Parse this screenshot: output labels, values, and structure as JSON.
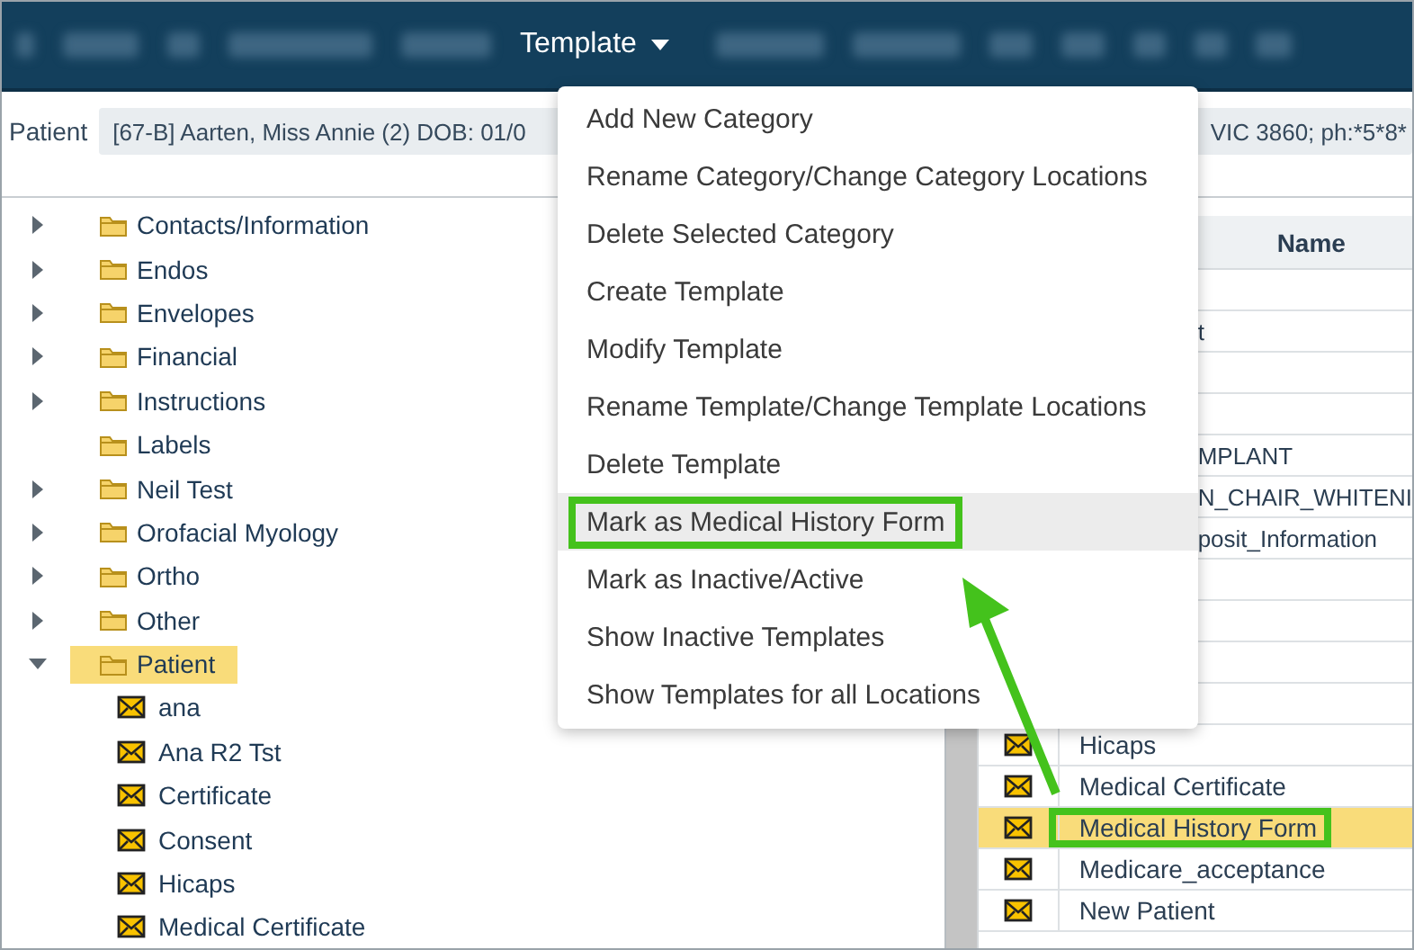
{
  "toolbar": {
    "menus": [
      {
        "label": "Template"
      }
    ]
  },
  "patient_bar": {
    "label": "Patient",
    "value_start": "[67-B] Aarten, Miss Annie (2) DOB: 01/0",
    "value_end": "VIC 3860; ph:*5*8*"
  },
  "tree": [
    {
      "label": "Contacts/Information",
      "expandable": true,
      "expanded": false,
      "selected": false
    },
    {
      "label": "Endos",
      "expandable": true,
      "expanded": false,
      "selected": false
    },
    {
      "label": "Envelopes",
      "expandable": true,
      "expanded": false,
      "selected": false
    },
    {
      "label": "Financial",
      "expandable": true,
      "expanded": false,
      "selected": false
    },
    {
      "label": "Instructions",
      "expandable": true,
      "expanded": false,
      "selected": false
    },
    {
      "label": "Labels",
      "expandable": false,
      "expanded": false,
      "selected": false
    },
    {
      "label": "Neil Test",
      "expandable": true,
      "expanded": false,
      "selected": false
    },
    {
      "label": "Orofacial Myology",
      "expandable": true,
      "expanded": false,
      "selected": false
    },
    {
      "label": "Ortho",
      "expandable": true,
      "expanded": false,
      "selected": false
    },
    {
      "label": "Other",
      "expandable": true,
      "expanded": false,
      "selected": false
    },
    {
      "label": "Patient",
      "expandable": true,
      "expanded": true,
      "selected": true,
      "children": [
        {
          "label": "ana"
        },
        {
          "label": "Ana R2 Tst"
        },
        {
          "label": "Certificate"
        },
        {
          "label": "Consent"
        },
        {
          "label": "Hicaps"
        },
        {
          "label": "Medical Certificate"
        }
      ]
    }
  ],
  "table": {
    "columns": [
      "Name"
    ],
    "covered_rows": [
      {},
      {
        "name": "t"
      },
      {},
      {},
      {
        "name": "MPLANT"
      },
      {
        "name": "N_CHAIR_WHITENI"
      },
      {
        "name": "posit_Information"
      },
      {},
      {},
      {},
      {}
    ],
    "rows": [
      {
        "name": "Hicaps",
        "selected": false,
        "highlighted": false
      },
      {
        "name": "Medical Certificate",
        "selected": false,
        "highlighted": false
      },
      {
        "name": "Medical History Form",
        "selected": true,
        "highlighted": true
      },
      {
        "name": "Medicare_acceptance",
        "selected": false,
        "highlighted": false
      },
      {
        "name": "New Patient",
        "selected": false,
        "highlighted": false
      }
    ]
  },
  "template_menu": [
    {
      "label": "Add New Category",
      "hovered": false,
      "highlighted": false
    },
    {
      "label": "Rename Category/Change Category Locations",
      "hovered": false,
      "highlighted": false
    },
    {
      "label": "Delete Selected Category",
      "hovered": false,
      "highlighted": false
    },
    {
      "label": "Create Template",
      "hovered": false,
      "highlighted": false
    },
    {
      "label": "Modify Template",
      "hovered": false,
      "highlighted": false
    },
    {
      "label": "Rename Template/Change Template Locations",
      "hovered": false,
      "highlighted": false
    },
    {
      "label": "Delete Template",
      "hovered": false,
      "highlighted": false
    },
    {
      "label": "Mark as Medical History Form",
      "hovered": true,
      "highlighted": true
    },
    {
      "label": "Mark as Inactive/Active",
      "hovered": false,
      "highlighted": false
    },
    {
      "label": "Show Inactive Templates",
      "hovered": false,
      "highlighted": false
    },
    {
      "label": "Show Templates for all Locations",
      "hovered": false,
      "highlighted": false
    }
  ]
}
